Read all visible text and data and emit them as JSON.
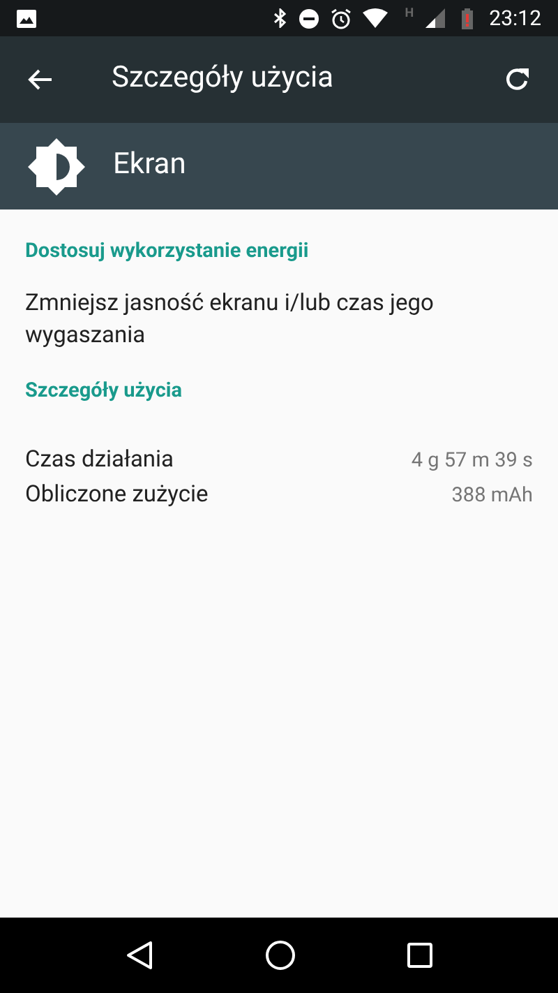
{
  "status_bar": {
    "network_type": "H",
    "time": "23:12"
  },
  "toolbar": {
    "title": "Szczegóły użycia"
  },
  "app_header": {
    "title": "Ekran"
  },
  "sections": [
    {
      "title": "Dostosuj wykorzystanie energii",
      "items": [
        {
          "kind": "text",
          "text": "Zmniejsz jasność ekranu i/lub czas jego wygaszania"
        }
      ]
    },
    {
      "title": "Szczegóły użycia",
      "items": [
        {
          "kind": "stat",
          "label": "Czas działania",
          "value": "4 g 57 m 39 s"
        },
        {
          "kind": "stat",
          "label": "Obliczone zużycie",
          "value": "388 mAh"
        }
      ]
    }
  ]
}
